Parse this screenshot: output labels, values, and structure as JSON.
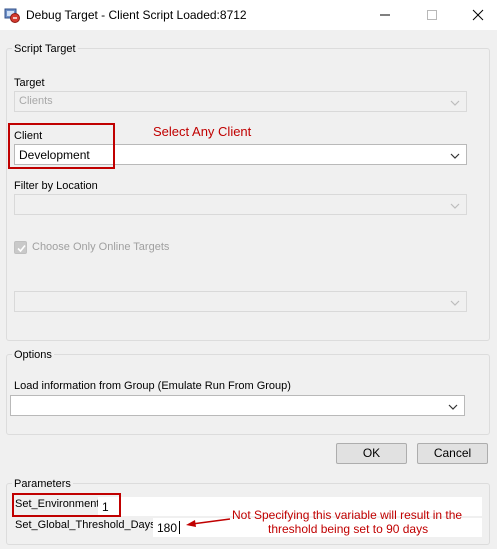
{
  "window": {
    "title": "Debug Target - Client Script Loaded:8712"
  },
  "script_target": {
    "legend": "Script Target",
    "target_label": "Target",
    "target_value": "Clients",
    "client_label": "Client",
    "client_value": "Development",
    "filter_label": "Filter by Location",
    "filter_value": "",
    "online_checkbox_label": "Choose Only Online Targets",
    "online_checked": true,
    "extra_value": ""
  },
  "options": {
    "legend": "Options",
    "group_label": "Load information from Group (Emulate Run From Group)",
    "group_value": ""
  },
  "buttons": {
    "ok_label": "OK",
    "cancel_label": "Cancel"
  },
  "parameters": {
    "legend": "Parameters",
    "rows": [
      {
        "name": "Set_Environment",
        "value": "1"
      },
      {
        "name": "Set_Global_Threshold_Days",
        "value": "180"
      }
    ]
  },
  "annotations": {
    "select_client": "Select Any Client",
    "threshold_note_line1": "Not Specifying this variable will result in the",
    "threshold_note_line2": "threshold being set to 90 days",
    "annotation_color": "#c00000"
  }
}
